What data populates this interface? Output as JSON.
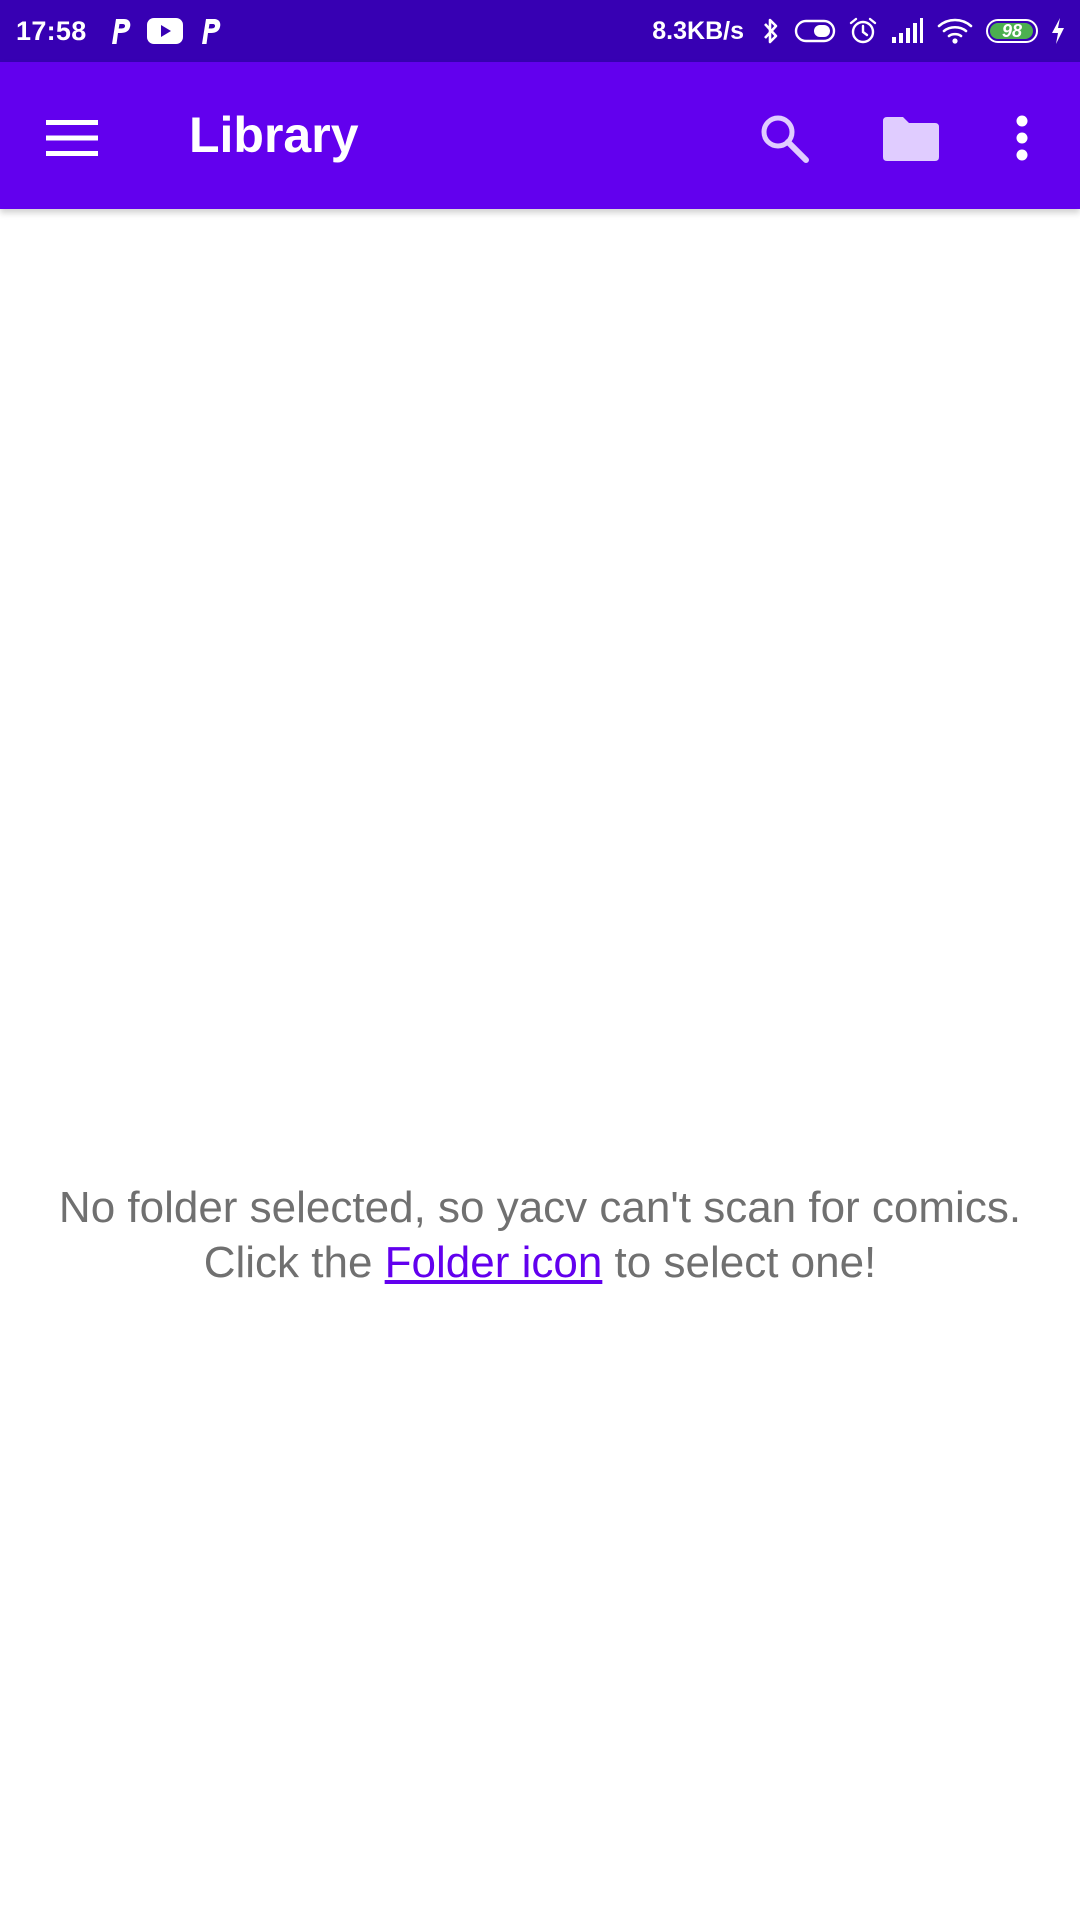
{
  "status_bar": {
    "time": "17:58",
    "network_speed": "8.3KB/s",
    "battery_level": "98",
    "battery_fraction": 0.98,
    "notification_icons": [
      "p-app-icon",
      "youtube-icon",
      "p-app-icon"
    ],
    "system_icons": [
      "bluetooth-icon",
      "vibrate-toggle-icon",
      "alarm-icon",
      "signal-icon",
      "wifi-icon",
      "battery-icon",
      "charging-icon"
    ]
  },
  "app_bar": {
    "title": "Library",
    "color": "#6200ee",
    "actions": [
      "search-icon",
      "folder-icon",
      "more-vert-icon"
    ]
  },
  "empty_state": {
    "text_before": "No folder selected, so yacv can't scan for comics. Click the ",
    "link_text": "Folder icon",
    "text_after": " to select one!"
  },
  "colors": {
    "status_bar": "#3700b3",
    "primary": "#6200ee",
    "message_text": "#707070",
    "link": "#6200ee",
    "battery_fill": "#4caf50"
  }
}
